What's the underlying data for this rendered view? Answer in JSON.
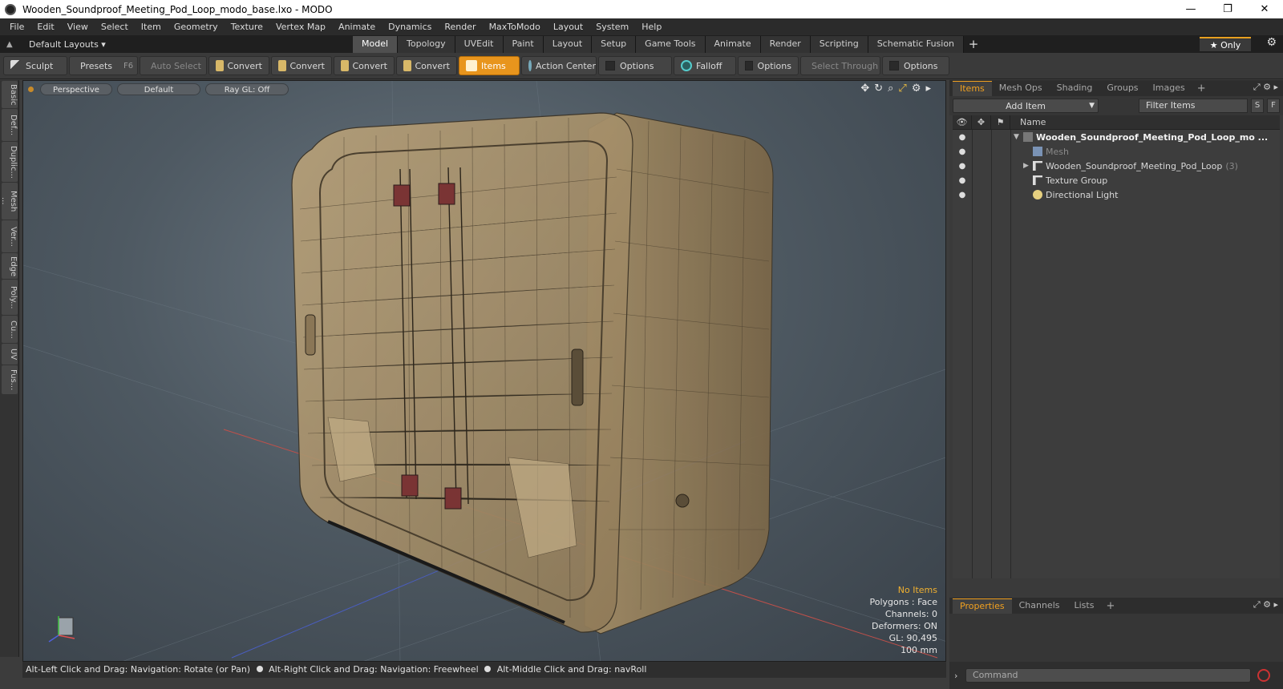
{
  "window": {
    "title": "Wooden_Soundproof_Meeting_Pod_Loop_modo_base.lxo - MODO",
    "minimize": "—",
    "maximize": "❐",
    "close": "✕"
  },
  "menu": [
    "File",
    "Edit",
    "View",
    "Select",
    "Item",
    "Geometry",
    "Texture",
    "Vertex Map",
    "Animate",
    "Dynamics",
    "Render",
    "MaxToModo",
    "Layout",
    "System",
    "Help"
  ],
  "layout_select": "Default Layouts ▾",
  "tabs": [
    "Model",
    "Topology",
    "UVEdit",
    "Paint",
    "Layout",
    "Setup",
    "Game Tools",
    "Animate",
    "Render",
    "Scripting",
    "Schematic Fusion"
  ],
  "active_tab": "Model",
  "only_label": "★  Only",
  "toolbar": {
    "sculpt": "Sculpt",
    "presets": "Presets",
    "presets_key": "F6",
    "auto_select": "Auto Select",
    "convert1": "Convert",
    "convert2": "Convert",
    "convert3": "Convert",
    "convert4": "Convert",
    "items": "Items",
    "action_center": "Action Center",
    "options1": "Options",
    "falloff": "Falloff",
    "options2": "Options",
    "select_through": "Select Through",
    "options3": "Options"
  },
  "left_tabs": [
    "Basic",
    "Def...",
    "Duplic...",
    "Mesh ...",
    "Ver...",
    "Edge",
    "Poly...",
    "Cu...",
    "UV",
    "Fus..."
  ],
  "viewport": {
    "view": "Perspective",
    "shading": "Default",
    "raygl": "Ray GL: Off",
    "info": {
      "no_items": "No Items",
      "polygons": "Polygons : Face",
      "channels": "Channels: 0",
      "deformers": "Deformers: ON",
      "gl": "GL: 90,495",
      "scale": "100 mm"
    }
  },
  "status": {
    "p1": "Alt-Left Click and Drag: Navigation: Rotate (or Pan)",
    "p2": "Alt-Right Click and Drag: Navigation: Freewheel",
    "p3": "Alt-Middle Click and Drag: navRoll"
  },
  "items_panel": {
    "tabs": [
      "Items",
      "Mesh Ops",
      "Shading",
      "Groups",
      "Images"
    ],
    "add_item": "Add Item",
    "filter_placeholder": "Filter Items",
    "s_btn": "S",
    "f_btn": "F",
    "name_col": "Name",
    "rows": [
      {
        "label": "Wooden_Soundproof_Meeting_Pod_Loop_mo ...",
        "count": ""
      },
      {
        "label": "Mesh",
        "count": ""
      },
      {
        "label": "Wooden_Soundproof_Meeting_Pod_Loop",
        "count": "(3)"
      },
      {
        "label": "Texture Group",
        "count": ""
      },
      {
        "label": "Directional Light",
        "count": ""
      }
    ]
  },
  "props_panel": {
    "tabs": [
      "Properties",
      "Channels",
      "Lists"
    ]
  },
  "command": {
    "placeholder": "Command"
  }
}
